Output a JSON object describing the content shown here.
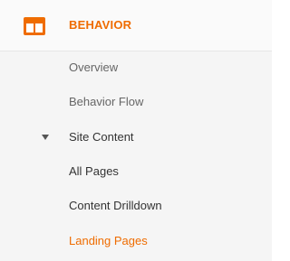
{
  "section": {
    "icon": "browser-window-icon",
    "title": "BEHAVIOR",
    "accent_color": "#ef6c00"
  },
  "items": [
    {
      "label": "Overview"
    },
    {
      "label": "Behavior Flow"
    },
    {
      "label": "Site Content",
      "expanded": true
    },
    {
      "label": "All Pages"
    },
    {
      "label": "Content Drilldown"
    },
    {
      "label": "Landing Pages",
      "active": true
    }
  ]
}
